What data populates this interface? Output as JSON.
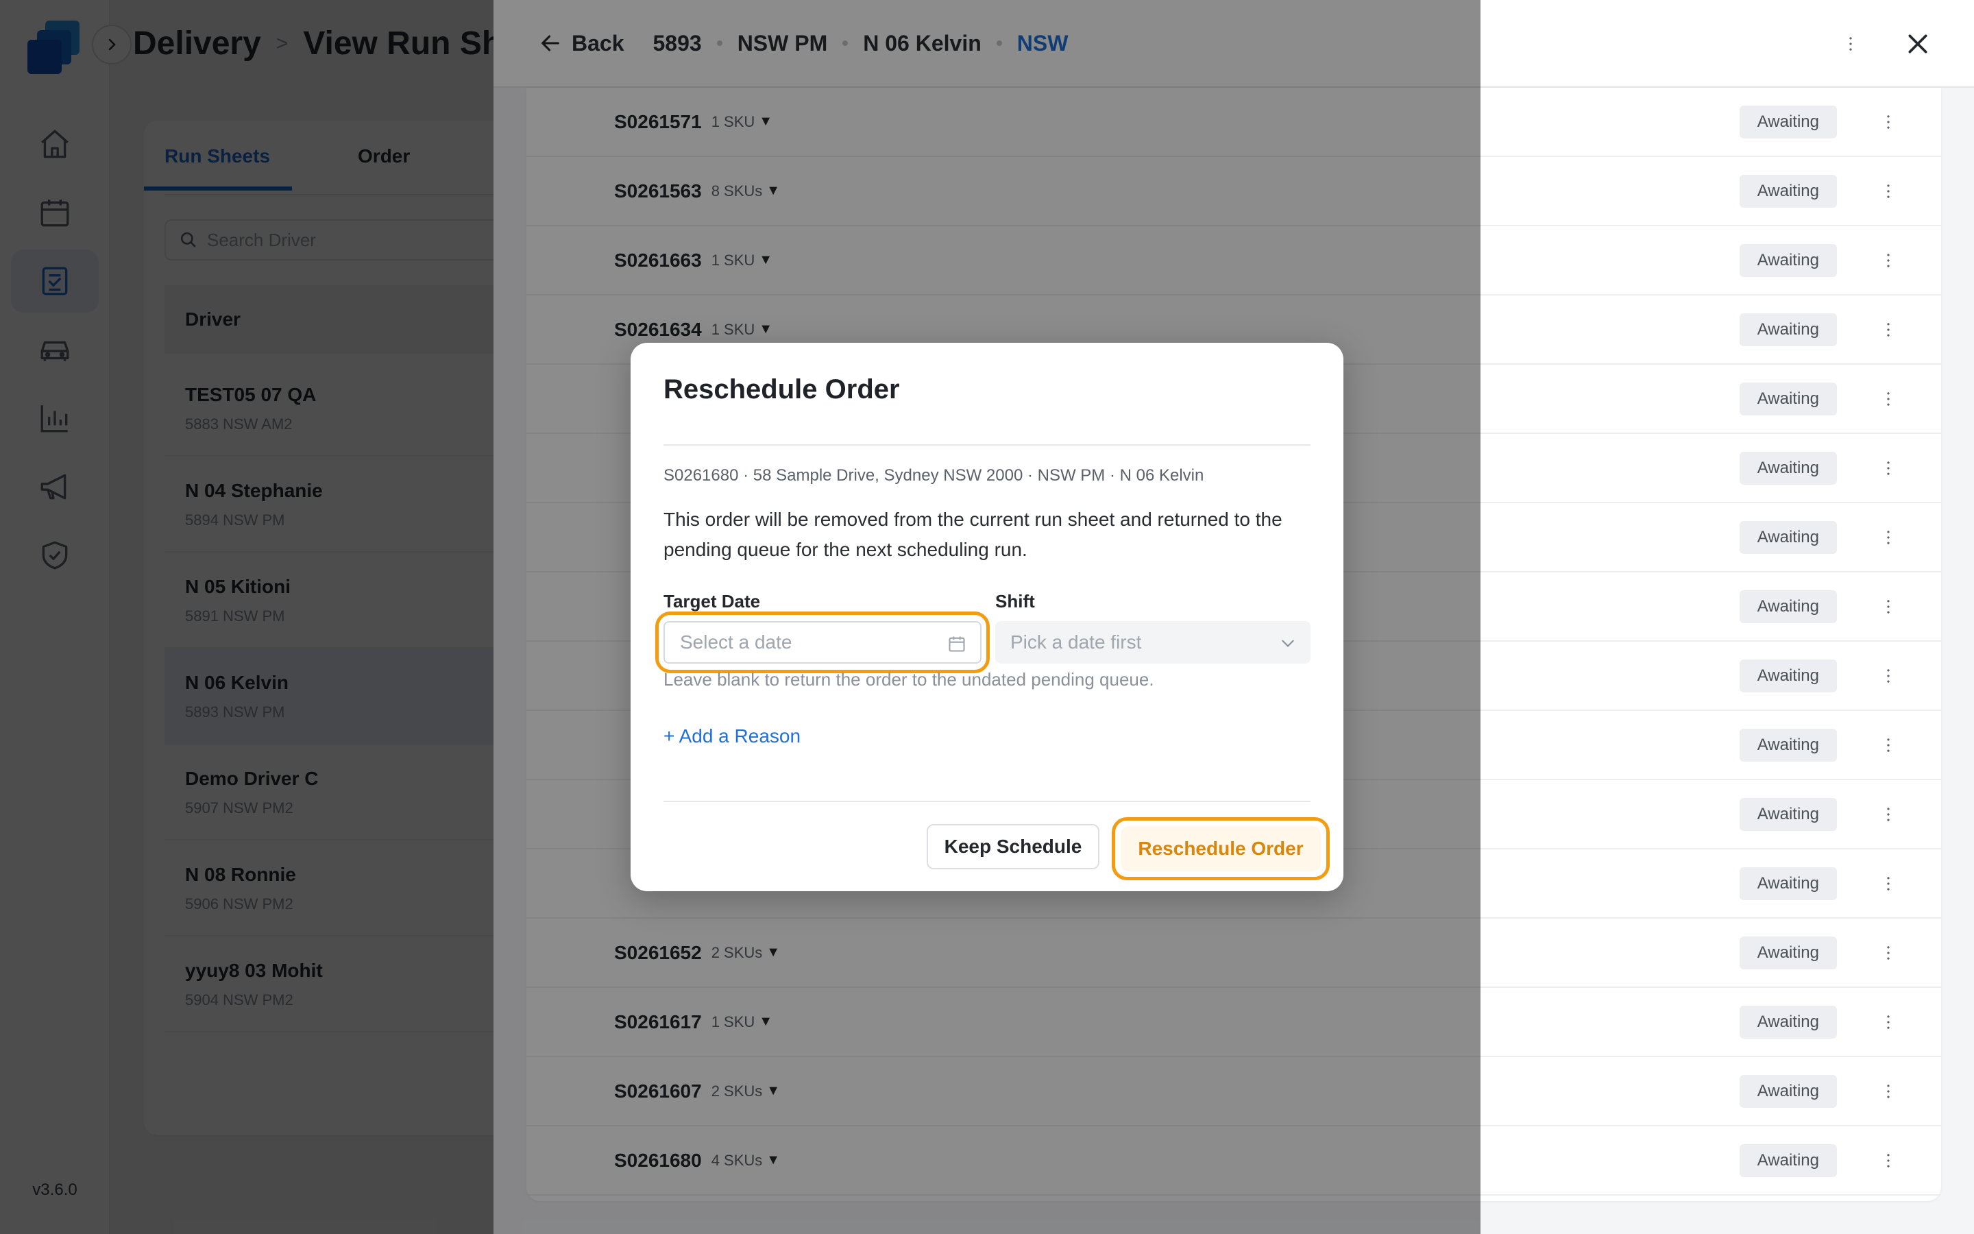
{
  "app": {
    "version": "v3.6.0",
    "accent_color": "#1f6fd6",
    "highlight_color": "#f29c11"
  },
  "rail": {
    "items": [
      {
        "icon": "home-icon"
      },
      {
        "icon": "calendar-icon"
      },
      {
        "icon": "run-sheet-icon",
        "active": true
      },
      {
        "icon": "vehicle-icon"
      },
      {
        "icon": "chart-icon"
      },
      {
        "icon": "megaphone-icon"
      },
      {
        "icon": "shield-check-icon"
      }
    ]
  },
  "page": {
    "breadcrumb": [
      "Delivery",
      "View Run She"
    ],
    "tabs": [
      "Run Sheets",
      "Order"
    ],
    "search_placeholder": "Search Driver",
    "driver_column": "Driver",
    "drivers": [
      {
        "name": "TEST05 07 QA",
        "sub": "5883 NSW AM2"
      },
      {
        "name": "N 04 Stephanie",
        "sub": "5894 NSW PM"
      },
      {
        "name": "N 05 Kitioni",
        "sub": "5891 NSW PM"
      },
      {
        "name": "N 06 Kelvin",
        "sub": "5893 NSW PM"
      },
      {
        "name": "Demo Driver C",
        "sub": "5907 NSW PM2"
      },
      {
        "name": "N 08 Ronnie",
        "sub": "5906 NSW PM2"
      },
      {
        "name": "yyuy8 03 Mohit",
        "sub": "5904 NSW PM2"
      }
    ]
  },
  "sheet": {
    "back_label": "Back",
    "run_id": "5893",
    "shift": "NSW PM",
    "driver": "N 06 Kelvin",
    "region": "NSW",
    "orders": [
      {
        "id": "S0261571",
        "sku": "1 SKU",
        "status": "Awaiting"
      },
      {
        "id": "S0261563",
        "sku": "8 SKUs",
        "status": "Awaiting"
      },
      {
        "id": "S0261663",
        "sku": "1 SKU",
        "status": "Awaiting"
      },
      {
        "id": "S0261634",
        "sku": "1 SKU",
        "status": "Awaiting"
      },
      {
        "id": "",
        "sku": "",
        "status": "Awaiting"
      },
      {
        "id": "",
        "sku": "",
        "status": "Awaiting"
      },
      {
        "id": "",
        "sku": "",
        "status": "Awaiting"
      },
      {
        "id": "",
        "sku": "",
        "status": "Awaiting"
      },
      {
        "id": "",
        "sku": "",
        "status": "Awaiting"
      },
      {
        "id": "",
        "sku": "",
        "status": "Awaiting"
      },
      {
        "id": "",
        "sku": "",
        "status": "Awaiting"
      },
      {
        "id": "",
        "sku": "",
        "status": "Awaiting"
      },
      {
        "id": "S0261652",
        "sku": "2 SKUs",
        "status": "Awaiting"
      },
      {
        "id": "S0261617",
        "sku": "1 SKU",
        "status": "Awaiting"
      },
      {
        "id": "S0261607",
        "sku": "2 SKUs",
        "status": "Awaiting"
      },
      {
        "id": "S0261680",
        "sku": "4 SKUs",
        "status": "Awaiting"
      }
    ]
  },
  "modal": {
    "title": "Reschedule Order",
    "meta": "S0261680 · 58 Sample Drive, Sydney NSW 2000 · NSW PM · N 06 Kelvin",
    "description": "This order will be removed from the current run sheet and returned to the pending queue for the next scheduling run.",
    "target_date_label": "Target Date",
    "target_date_placeholder": "Select a date",
    "shift_label": "Shift",
    "shift_placeholder": "Pick a date first",
    "hint": "Leave blank to return the order to the undated pending queue.",
    "add_reason": "+ Add a Reason",
    "keep_button": "Keep Schedule",
    "confirm_button": "Reschedule Order"
  }
}
